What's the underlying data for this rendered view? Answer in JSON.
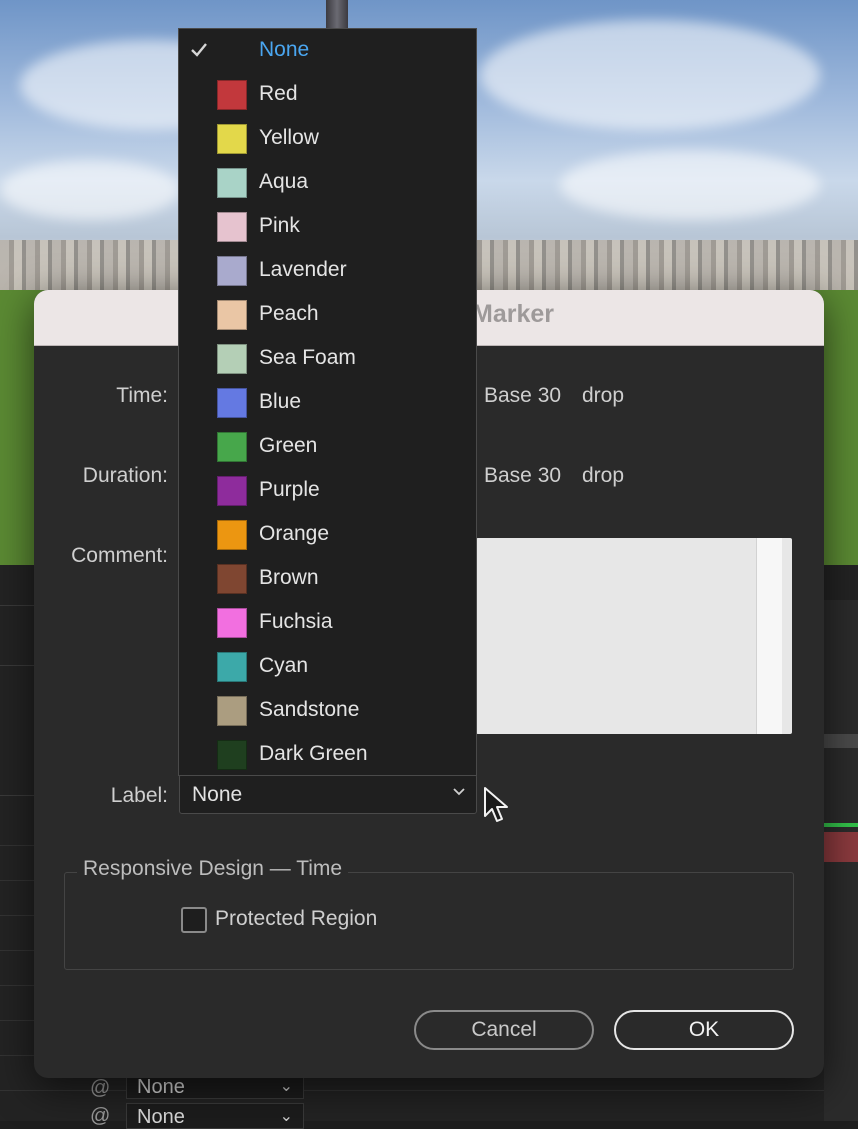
{
  "dialog": {
    "title": "Marker",
    "time_label": "Time:",
    "time_base": "Base 30",
    "time_drop": "drop",
    "duration_label": "Duration:",
    "duration_base": "Base 30",
    "duration_drop": "drop",
    "comment_label": "Comment:",
    "label_label": "Label:",
    "label_value": "None",
    "group_title": "Responsive Design — Time",
    "protected_region": "Protected Region",
    "cancel": "Cancel",
    "ok": "OK"
  },
  "menu": {
    "items": [
      {
        "label": "None",
        "color": "",
        "selected": true
      },
      {
        "label": "Red",
        "color": "#c2383c"
      },
      {
        "label": "Yellow",
        "color": "#e3d84a"
      },
      {
        "label": "Aqua",
        "color": "#a9d3c7"
      },
      {
        "label": "Pink",
        "color": "#e6c3cf"
      },
      {
        "label": "Lavender",
        "color": "#a9aacd"
      },
      {
        "label": "Peach",
        "color": "#eac6a5"
      },
      {
        "label": "Sea Foam",
        "color": "#b4cfb6"
      },
      {
        "label": "Blue",
        "color": "#6479e2"
      },
      {
        "label": "Green",
        "color": "#47a74b"
      },
      {
        "label": "Purple",
        "color": "#8e2c9c"
      },
      {
        "label": "Orange",
        "color": "#ec9611"
      },
      {
        "label": "Brown",
        "color": "#7f4631"
      },
      {
        "label": "Fuchsia",
        "color": "#f26fe0"
      },
      {
        "label": "Cyan",
        "color": "#3ca9a9"
      },
      {
        "label": "Sandstone",
        "color": "#ab9d80"
      },
      {
        "label": "Dark Green",
        "color": "#1f3f1f"
      }
    ]
  },
  "app": {
    "row_select_1": "None",
    "row_select_2": "None"
  }
}
